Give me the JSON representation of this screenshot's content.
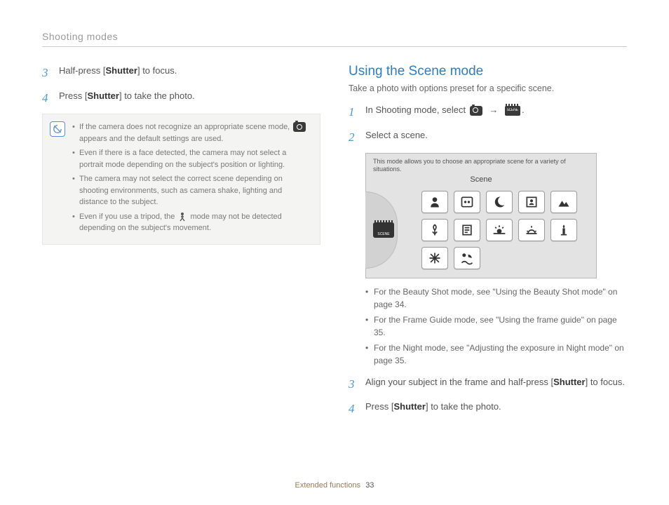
{
  "header": {
    "breadcrumb": "Shooting modes"
  },
  "left": {
    "steps": [
      {
        "n": "3",
        "pre": "Half-press [",
        "kw": "Shutter",
        "post": "] to focus."
      },
      {
        "n": "4",
        "pre": "Press [",
        "kw": "Shutter",
        "post": "] to take the photo."
      }
    ],
    "notes": [
      "If the camera does not recognize an appropriate scene mode,  appears and the default settings are used.",
      "Even if there is a face detected, the camera may not select a portrait mode depending on the subject's position or lighting.",
      "The camera may not select the correct scene depending on shooting environments, such as camera shake, lighting and distance to the subject.",
      "Even if you use a tripod, the  mode may not be detected depending on the subject's movement."
    ]
  },
  "right": {
    "title": "Using the Scene mode",
    "subtitle": "Take a photo with options preset for a specific scene.",
    "step1": {
      "n": "1",
      "text": "In Shooting mode, select"
    },
    "step2": {
      "n": "2",
      "text": "Select a scene."
    },
    "screenshot": {
      "desc": "This mode allows you to choose an appropriate scene for a variety of situations.",
      "title": "Scene",
      "dial_label": "SCENE",
      "icons": [
        "portrait-icon",
        "children-icon",
        "night-icon",
        "closeup-face-icon",
        "landscape-icon",
        "macro-icon",
        "text-icon",
        "sunset-icon",
        "dawn-icon",
        "candle-icon",
        "firework-icon",
        "beach-icon"
      ]
    },
    "bullets": [
      "For the Beauty Shot mode, see \"Using the Beauty Shot mode\" on page 34.",
      "For the Frame Guide mode, see \"Using the frame guide\" on page 35.",
      "For the Night mode, see \"Adjusting the exposure in Night mode\" on page 35."
    ],
    "step3": {
      "n": "3",
      "pre": "Align your subject in the frame and half-press [",
      "kw": "Shutter",
      "post": "] to focus."
    },
    "step4": {
      "n": "4",
      "pre": "Press [",
      "kw": "Shutter",
      "post": "] to take the photo."
    }
  },
  "footer": {
    "section": "Extended functions",
    "page": "33"
  }
}
